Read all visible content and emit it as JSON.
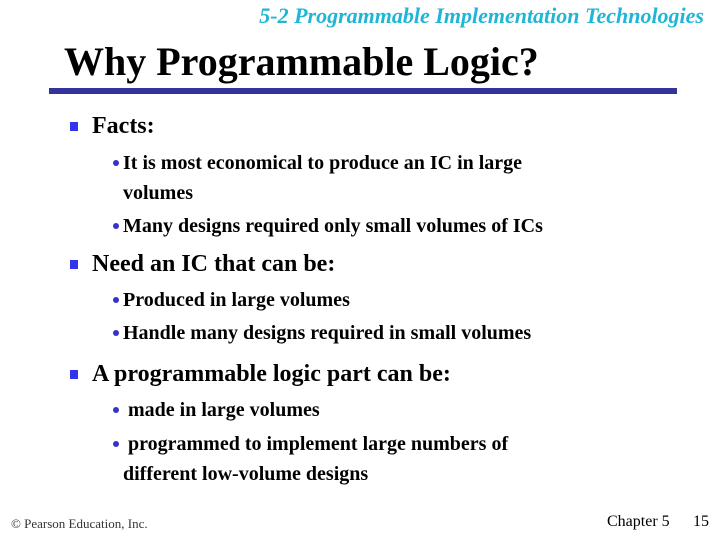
{
  "slide": {
    "chapter_header": "5-2 Programmable Implementation Technologies",
    "title": "Why Programmable Logic?",
    "sections": [
      {
        "heading": "Facts:",
        "items": [
          {
            "line1": "It is most economical to produce an IC in large",
            "line2": "volumes"
          },
          {
            "line1": "Many designs required only small volumes of ICs",
            "line2": ""
          }
        ]
      },
      {
        "heading": "Need an IC that can be:",
        "items": [
          {
            "line1": "Produced in large volumes",
            "line2": ""
          },
          {
            "line1": "Handle many designs required in small volumes",
            "line2": ""
          }
        ]
      },
      {
        "heading": "A programmable logic part can be:",
        "items": [
          {
            "line1": " made in large volumes",
            "line2": ""
          },
          {
            "line1": " programmed to implement large numbers of",
            "line2": "different low-volume designs"
          }
        ]
      }
    ],
    "icons": {
      "level1_bullet": "square-bullet-icon",
      "level2_bullet": "round-bullet-icon"
    },
    "colors": {
      "header_text": "#1fb6d6",
      "title_rule": "#333399",
      "bullet_square": "#3333ee",
      "bullet_dot": "#3333cc"
    }
  },
  "footer": {
    "copyright": "© Pearson Education, Inc.",
    "chapter": "Chapter 5",
    "page_number": "15"
  }
}
